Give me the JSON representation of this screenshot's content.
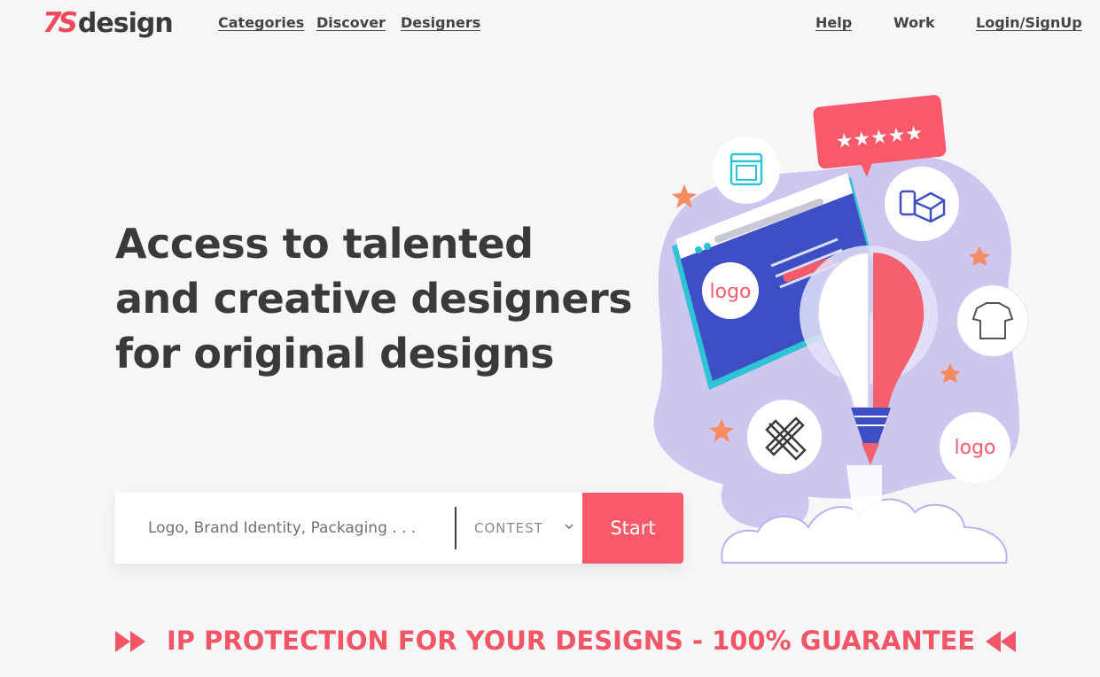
{
  "header": {
    "logo_mark": "7S",
    "logo_word": "design",
    "nav": {
      "categories": "Categories",
      "discover": "Discover",
      "designers": "Designers",
      "help": "Help",
      "work": "Work",
      "login": "Login/SignUp"
    }
  },
  "hero": {
    "headline_line1": "Access to talented",
    "headline_line2": "and creative designers",
    "headline_line3": "for original designs"
  },
  "search": {
    "placeholder": "Logo, Brand Identity, Packaging . . .",
    "type_value": "CONTEST",
    "start_label": "Start"
  },
  "banner": {
    "text": "IP PROTECTION FOR YOUR DESIGNS - 100% GUARANTEE"
  },
  "illustration": {
    "logo_text_1": "logo",
    "logo_text_2": "logo",
    "icons": [
      "browser-window-icon",
      "rating-stars-icon",
      "packaging-box-icon",
      "tshirt-icon",
      "pencil-ruler-icon",
      "logo-badge-icon",
      "lightbulb-brain-icon"
    ]
  },
  "colors": {
    "brand": "#ef4a5c",
    "start_button": "#f95a6a",
    "text_dark": "#3a3a3c",
    "lavender": "#c9c3ee",
    "background": "#f6f6f8"
  }
}
